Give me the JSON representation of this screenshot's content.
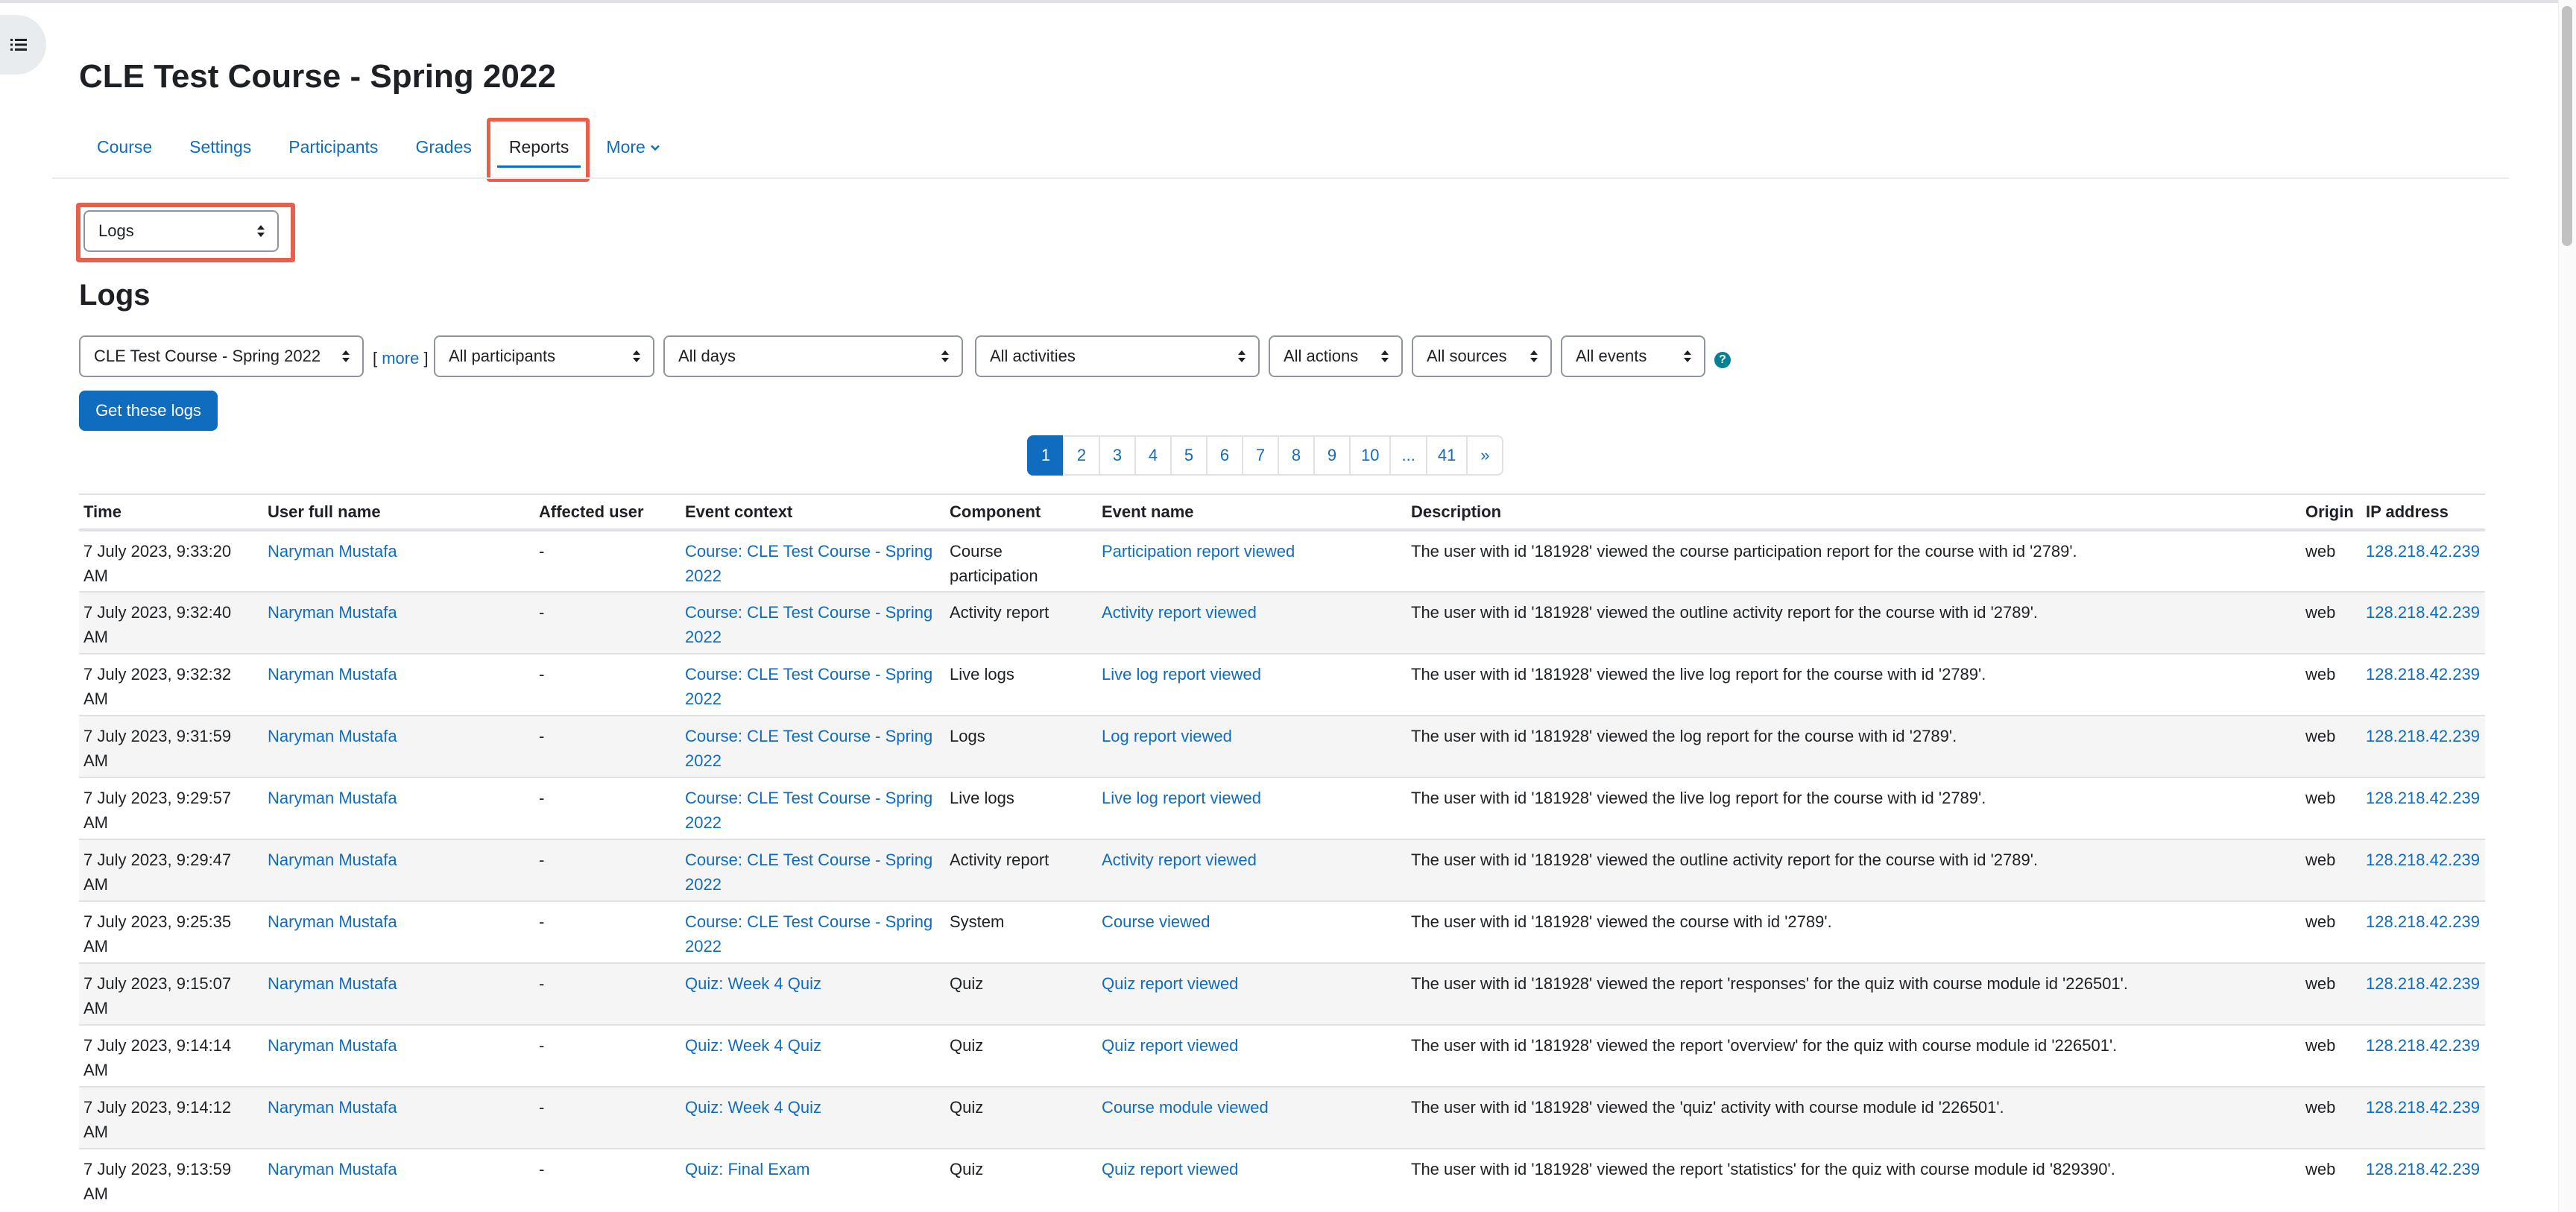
{
  "course": {
    "title": "CLE Test Course - Spring 2022"
  },
  "nav": {
    "items": [
      {
        "label": "Course"
      },
      {
        "label": "Settings"
      },
      {
        "label": "Participants"
      },
      {
        "label": "Grades"
      },
      {
        "label": "Reports"
      },
      {
        "label": "More"
      }
    ],
    "active": "Reports"
  },
  "report_selector": {
    "value": "Logs"
  },
  "logs": {
    "heading": "Logs",
    "filters": {
      "course": "CLE Test Course - Spring 2022",
      "more_link": "more",
      "participants": "All participants",
      "days": "All days",
      "activities": "All activities",
      "actions": "All actions",
      "sources": "All sources",
      "events": "All events"
    },
    "get_logs_button": "Get these logs",
    "help_icon": "question-circle-icon"
  },
  "pagination": {
    "pages": [
      "1",
      "2",
      "3",
      "4",
      "5",
      "6",
      "7",
      "8",
      "9",
      "10",
      "...",
      "41",
      "»"
    ],
    "current": "1"
  },
  "table": {
    "headers": [
      "Time",
      "User full name",
      "Affected user",
      "Event context",
      "Component",
      "Event name",
      "Description",
      "Origin",
      "IP address"
    ],
    "rows": [
      [
        "7 July 2023, 9:33:20 AM",
        "Naryman Mustafa",
        "-",
        "Course: CLE Test Course - Spring 2022",
        "Course participation",
        "Participation report viewed",
        "The user with id '181928' viewed the course participation report for the course with id '2789'.",
        "web",
        "128.218.42.239"
      ],
      [
        "7 July 2023, 9:32:40 AM",
        "Naryman Mustafa",
        "-",
        "Course: CLE Test Course - Spring 2022",
        "Activity report",
        "Activity report viewed",
        "The user with id '181928' viewed the outline activity report for the course with id '2789'.",
        "web",
        "128.218.42.239"
      ],
      [
        "7 July 2023, 9:32:32 AM",
        "Naryman Mustafa",
        "-",
        "Course: CLE Test Course - Spring 2022",
        "Live logs",
        "Live log report viewed",
        "The user with id '181928' viewed the live log report for the course with id '2789'.",
        "web",
        "128.218.42.239"
      ],
      [
        "7 July 2023, 9:31:59 AM",
        "Naryman Mustafa",
        "-",
        "Course: CLE Test Course - Spring 2022",
        "Logs",
        "Log report viewed",
        "The user with id '181928' viewed the log report for the course with id '2789'.",
        "web",
        "128.218.42.239"
      ],
      [
        "7 July 2023, 9:29:57 AM",
        "Naryman Mustafa",
        "-",
        "Course: CLE Test Course - Spring 2022",
        "Live logs",
        "Live log report viewed",
        "The user with id '181928' viewed the live log report for the course with id '2789'.",
        "web",
        "128.218.42.239"
      ],
      [
        "7 July 2023, 9:29:47 AM",
        "Naryman Mustafa",
        "-",
        "Course: CLE Test Course - Spring 2022",
        "Activity report",
        "Activity report viewed",
        "The user with id '181928' viewed the outline activity report for the course with id '2789'.",
        "web",
        "128.218.42.239"
      ],
      [
        "7 July 2023, 9:25:35 AM",
        "Naryman Mustafa",
        "-",
        "Course: CLE Test Course - Spring 2022",
        "System",
        "Course viewed",
        "The user with id '181928' viewed the course with id '2789'.",
        "web",
        "128.218.42.239"
      ],
      [
        "7 July 2023, 9:15:07 AM",
        "Naryman Mustafa",
        "-",
        "Quiz: Week 4 Quiz",
        "Quiz",
        "Quiz report viewed",
        "The user with id '181928' viewed the report 'responses' for the quiz with course module id '226501'.",
        "web",
        "128.218.42.239"
      ],
      [
        "7 July 2023, 9:14:14 AM",
        "Naryman Mustafa",
        "-",
        "Quiz: Week 4 Quiz",
        "Quiz",
        "Quiz report viewed",
        "The user with id '181928' viewed the report 'overview' for the quiz with course module id '226501'.",
        "web",
        "128.218.42.239"
      ],
      [
        "7 July 2023, 9:14:12 AM",
        "Naryman Mustafa",
        "-",
        "Quiz: Week 4 Quiz",
        "Quiz",
        "Course module viewed",
        "The user with id '181928' viewed the 'quiz' activity with course module id '226501'.",
        "web",
        "128.218.42.239"
      ],
      [
        "7 July 2023, 9:13:59 AM",
        "Naryman Mustafa",
        "-",
        "Quiz: Final Exam",
        "Quiz",
        "Quiz report viewed",
        "The user with id '181928' viewed the report 'statistics' for the quiz with course module id '829390'.",
        "web",
        "128.218.42.239"
      ]
    ]
  },
  "colors": {
    "link": "#0f6cbf",
    "highlight": "#e8604c",
    "stripe": "#f5f5f5",
    "primary_button": "#0f6cbf"
  }
}
